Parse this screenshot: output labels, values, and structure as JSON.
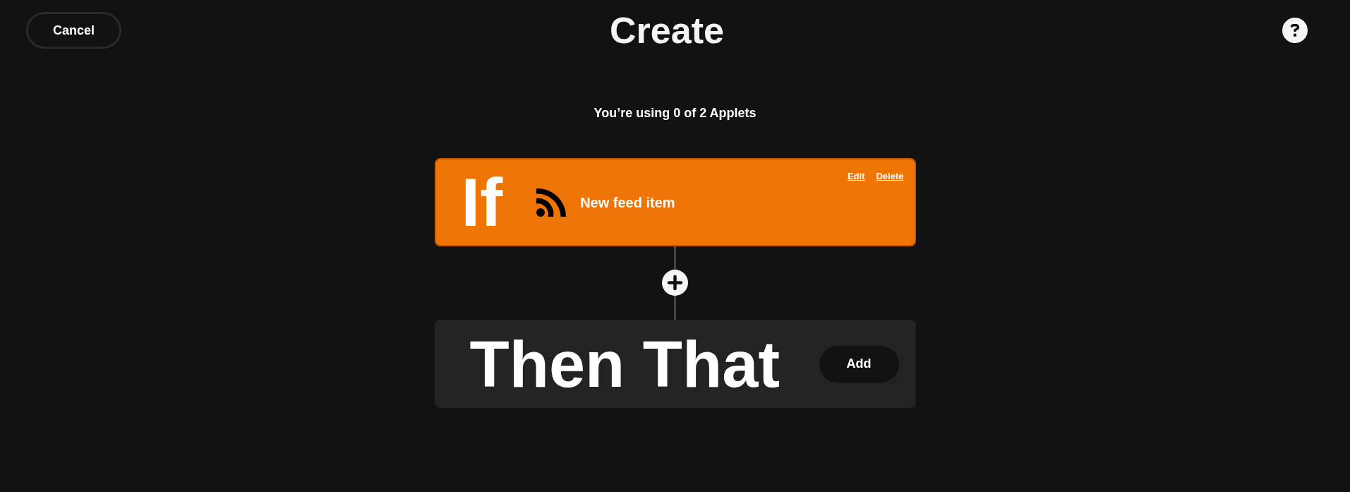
{
  "header": {
    "cancel_button": "Cancel",
    "title": "Create"
  },
  "usage_text": "You’re using 0 of 2 Applets",
  "trigger": {
    "label": "If",
    "event": "New feed item",
    "links": [
      "Edit",
      "Delete"
    ]
  },
  "action": {
    "label": "Then That",
    "add_button": "Add"
  }
}
